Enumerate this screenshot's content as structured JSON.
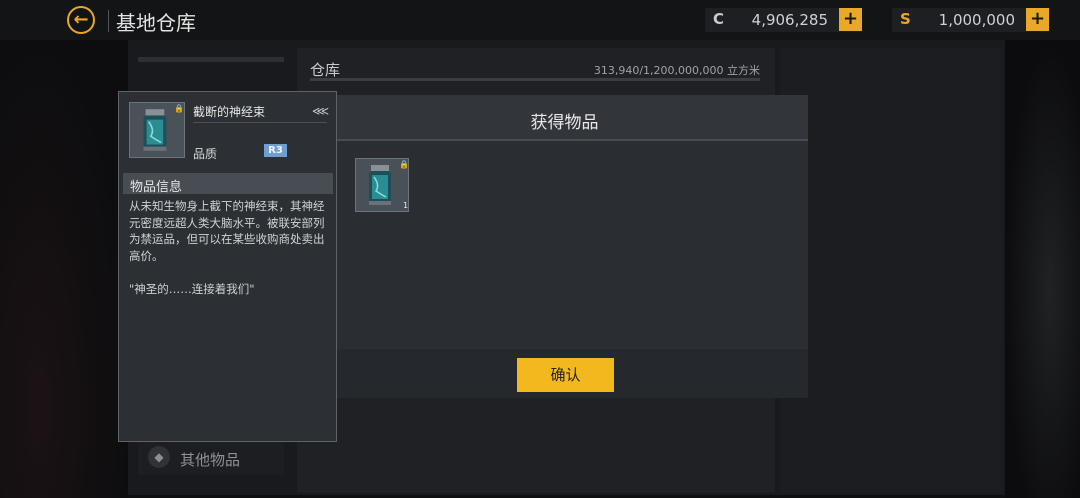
{
  "header": {
    "title": "基地仓库",
    "currency_c": {
      "symbol": "C",
      "value": "4,906,285",
      "add": "+",
      "color": "#e9a825"
    },
    "currency_s": {
      "symbol": "S",
      "value": "1,000,000",
      "add": "+",
      "color": "#e9a825"
    }
  },
  "warehouse": {
    "label": "仓库",
    "capacity": "313,940/1,200,000,000 立方米"
  },
  "nav": {
    "other_items": "其他物品"
  },
  "modal": {
    "title": "获得物品",
    "items": [
      {
        "icon": "neural-bundle-canister-icon",
        "locked": true,
        "count": "1"
      }
    ],
    "confirm": "确认"
  },
  "tooltip": {
    "name": "截断的神经束",
    "quality_label": "品质",
    "quality": "R3",
    "quality_color": "#6f9fd0",
    "section_title": "物品信息",
    "description": "从未知生物身上截下的神经束，其神经元密度远超人类大脑水平。被联安部列为禁运品，但可以在某些收购商处卖出高价。",
    "quote": "\"神圣的……连接着我们\""
  }
}
